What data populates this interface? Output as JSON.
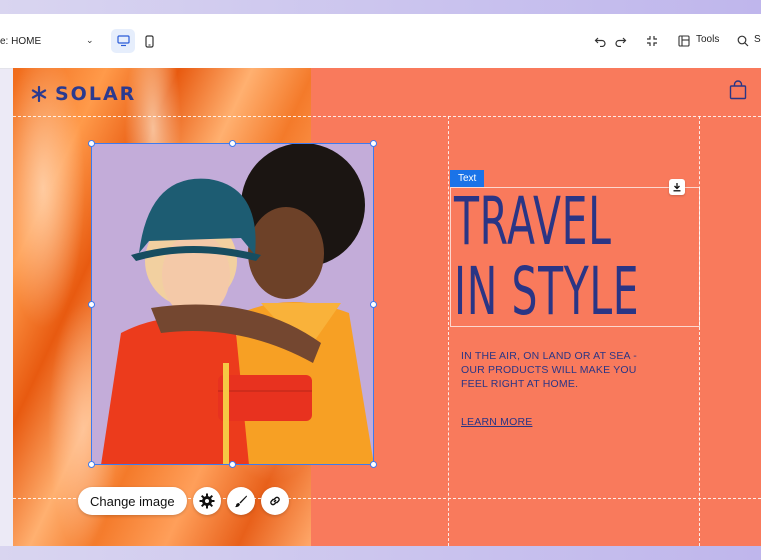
{
  "editor": {
    "page_label": "e: HOME",
    "tools_label": "Tools",
    "search_label": "S"
  },
  "site": {
    "logo_text": "SOLAR",
    "headline_line1": "TRAVEL",
    "headline_line2": "IN STYLE",
    "subcopy": "IN THE AIR, ON LAND OR AT SEA - OUR PRODUCTS WILL MAKE YOU FEEL RIGHT AT HOME.",
    "cta": "LEARN MORE"
  },
  "selection": {
    "text_tag": "Text",
    "change_image_label": "Change image",
    "accent_color": "#3d7bf0"
  },
  "colors": {
    "canvas_bg": "#f97a5c",
    "brand_navy": "#2a3585"
  },
  "icons": [
    "desktop-icon",
    "mobile-icon",
    "undo-icon",
    "redo-icon",
    "fit-icon",
    "tools-icon",
    "search-icon",
    "bag-icon",
    "settings-icon",
    "brush-icon",
    "link-icon",
    "download-icon"
  ]
}
